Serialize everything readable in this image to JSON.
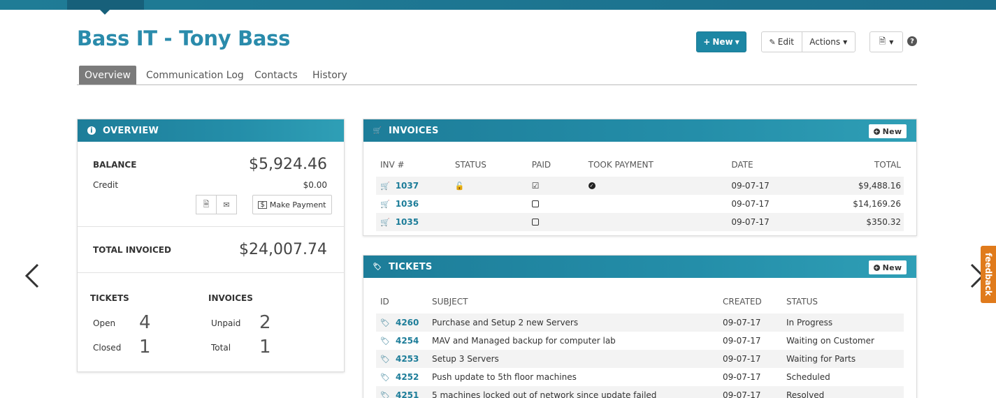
{
  "header": {
    "title": "Bass IT - Tony Bass",
    "new_label": "New",
    "edit_label": "Edit",
    "actions_label": "Actions"
  },
  "tabs": [
    {
      "label": "Overview",
      "active": true
    },
    {
      "label": "Communication Log"
    },
    {
      "label": "Contacts"
    },
    {
      "label": "History"
    }
  ],
  "overview": {
    "title": "OVERVIEW",
    "balance_label": "BALANCE",
    "balance_value": "$5,924.46",
    "credit_label": "Credit",
    "credit_value": "$0.00",
    "make_payment": "Make Payment",
    "total_invoiced_label": "TOTAL INVOICED",
    "total_invoiced_value": "$24,007.74",
    "tickets_label": "TICKETS",
    "invoices_label": "INVOICES",
    "open_label": "Open",
    "open_value": "4",
    "closed_label": "Closed",
    "closed_value": "1",
    "unpaid_label": "Unpaid",
    "unpaid_value": "2",
    "total_label": "Total",
    "total_value": "1"
  },
  "invoices": {
    "title": "INVOICES",
    "new_label": "New",
    "columns": [
      "INV #",
      "STATUS",
      "PAID",
      "TOOK PAYMENT",
      "DATE",
      "TOTAL"
    ],
    "rows": [
      {
        "id": "1037",
        "date": "09-07-17",
        "total": "$9,488.16"
      },
      {
        "id": "1036",
        "date": "09-07-17",
        "total": "$14,169.26"
      },
      {
        "id": "1035",
        "date": "09-07-17",
        "total": "$350.32"
      }
    ]
  },
  "tickets": {
    "title": "TICKETS",
    "new_label": "New",
    "columns": [
      "ID",
      "SUBJECT",
      "CREATED",
      "STATUS"
    ],
    "rows": [
      {
        "id": "4260",
        "subject": "Purchase and Setup 2 new Servers",
        "created": "09-07-17",
        "status": "In Progress"
      },
      {
        "id": "4254",
        "subject": "MAV and Managed backup for computer lab",
        "created": "09-07-17",
        "status": "Waiting on Customer"
      },
      {
        "id": "4253",
        "subject": "Setup 3 Servers",
        "created": "09-07-17",
        "status": "Waiting for Parts"
      },
      {
        "id": "4252",
        "subject": "Push update to 5th floor machines",
        "created": "09-07-17",
        "status": "Scheduled"
      },
      {
        "id": "4251",
        "subject": "5 machines locked out of network since update failed",
        "created": "09-07-17",
        "status": "Resolved"
      }
    ]
  },
  "feedback_label": "feedback",
  "colors": {
    "accent": "#1d87a4",
    "title": "#2a8bab",
    "feedback": "#e07b1c"
  }
}
